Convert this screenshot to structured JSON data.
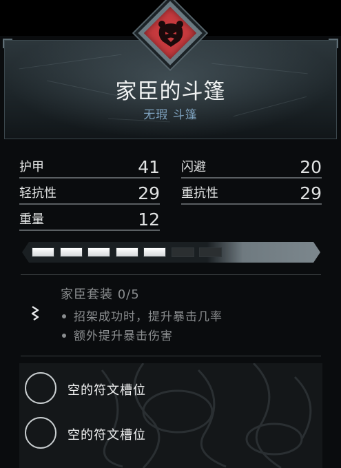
{
  "item": {
    "name": "家臣的斗篷",
    "subtitle": "无瑕 斗篷",
    "emblem_icon": "bear-head-icon",
    "emblem_color": "#c73a3e"
  },
  "stats": [
    {
      "label": "护甲",
      "value": "41"
    },
    {
      "label": "闪避",
      "value": "20"
    },
    {
      "label": "轻抗性",
      "value": "29"
    },
    {
      "label": "重抗性",
      "value": "29"
    },
    {
      "label": "重量",
      "value": "12"
    }
  ],
  "upgrade": {
    "filled": 5,
    "total": 7
  },
  "set": {
    "icon": "rune-sigil-icon",
    "name": "家臣套装 0/5",
    "bonuses": [
      "招架成功时，提升暴击几率",
      "额外提升暴击伤害"
    ]
  },
  "rune_slots": [
    {
      "label": "空的符文槽位"
    },
    {
      "label": "空的符文槽位"
    }
  ]
}
